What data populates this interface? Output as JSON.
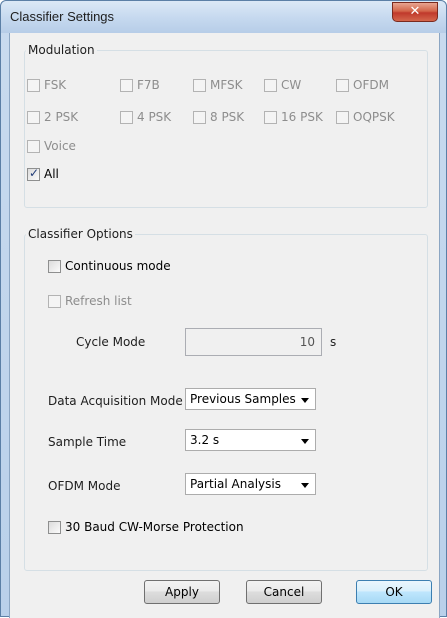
{
  "window": {
    "title": "Classifier Settings",
    "close_glyph": "✕"
  },
  "modulation": {
    "title": "Modulation",
    "items": [
      {
        "label": "FSK",
        "checked": false,
        "enabled": false
      },
      {
        "label": "F7B",
        "checked": false,
        "enabled": false
      },
      {
        "label": "MFSK",
        "checked": false,
        "enabled": false
      },
      {
        "label": "CW",
        "checked": false,
        "enabled": false
      },
      {
        "label": "OFDM",
        "checked": false,
        "enabled": false
      },
      {
        "label": "2 PSK",
        "checked": false,
        "enabled": false
      },
      {
        "label": "4 PSK",
        "checked": false,
        "enabled": false
      },
      {
        "label": "8 PSK",
        "checked": false,
        "enabled": false
      },
      {
        "label": "16 PSK",
        "checked": false,
        "enabled": false
      },
      {
        "label": "OQPSK",
        "checked": false,
        "enabled": false
      },
      {
        "label": "Voice",
        "checked": false,
        "enabled": false
      }
    ],
    "all": {
      "label": "All",
      "checked": true,
      "check_glyph": "✓"
    }
  },
  "options": {
    "title": "Classifier Options",
    "continuous_mode": "Continuous mode",
    "refresh_list": "Refresh list",
    "cycle_mode_label": "Cycle Mode",
    "cycle_mode_value": "10",
    "cycle_mode_unit": "s",
    "data_acq_label": "Data Acquisition Mode",
    "data_acq_value": "Previous Samples",
    "sample_time_label": "Sample Time",
    "sample_time_value": "3.2 s",
    "ofdm_mode_label": "OFDM Mode",
    "ofdm_mode_value": "Partial Analysis",
    "baud_protection": "30 Baud CW-Morse Protection"
  },
  "buttons": {
    "apply": "Apply",
    "cancel": "Cancel",
    "ok": "OK"
  }
}
